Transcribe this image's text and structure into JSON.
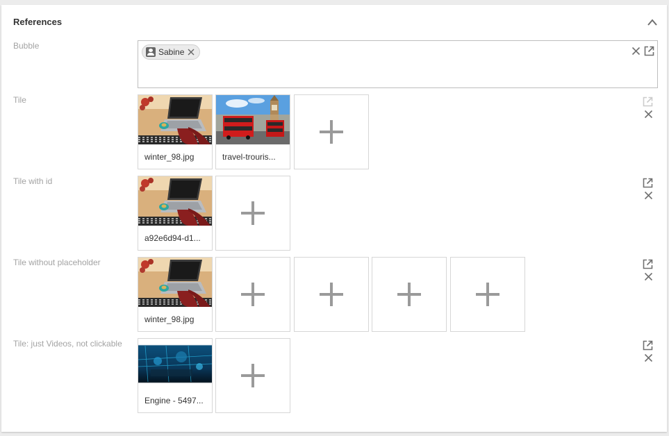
{
  "panel": {
    "title": "References"
  },
  "rows": [
    {
      "label": "Bubble",
      "chips": [
        {
          "label": "Sabine",
          "icon": "person-icon"
        }
      ]
    },
    {
      "label": "Tile",
      "tiles": [
        {
          "caption": "winter_98.jpg",
          "image": "laptop-desk-photo"
        },
        {
          "caption": "travel-trouris...",
          "image": "london-bus-photo"
        }
      ]
    },
    {
      "label": "Tile with id",
      "tiles": [
        {
          "caption": "a92e6d94-d1...",
          "image": "laptop-desk-photo"
        }
      ]
    },
    {
      "label": "Tile without placeholder",
      "tiles": [
        {
          "caption": "winter_98.jpg",
          "image": "laptop-desk-photo"
        }
      ]
    },
    {
      "label": "Tile: just Videos, not clickable",
      "tiles": [
        {
          "caption": "Engine - 5497...",
          "image": "engine-video-still"
        }
      ]
    }
  ],
  "colors": {
    "page_background": "#ececec",
    "panel_background": "#ffffff",
    "label_text": "#a3a3a3",
    "border": "#d6d6d6",
    "icon": "#707070",
    "icon_disabled": "#cccccc",
    "chip_background": "#ebebeb"
  },
  "icons": {
    "collapse": "chevron-up-icon",
    "clear": "close-icon",
    "open": "open-external-icon",
    "add": "plus-icon"
  }
}
